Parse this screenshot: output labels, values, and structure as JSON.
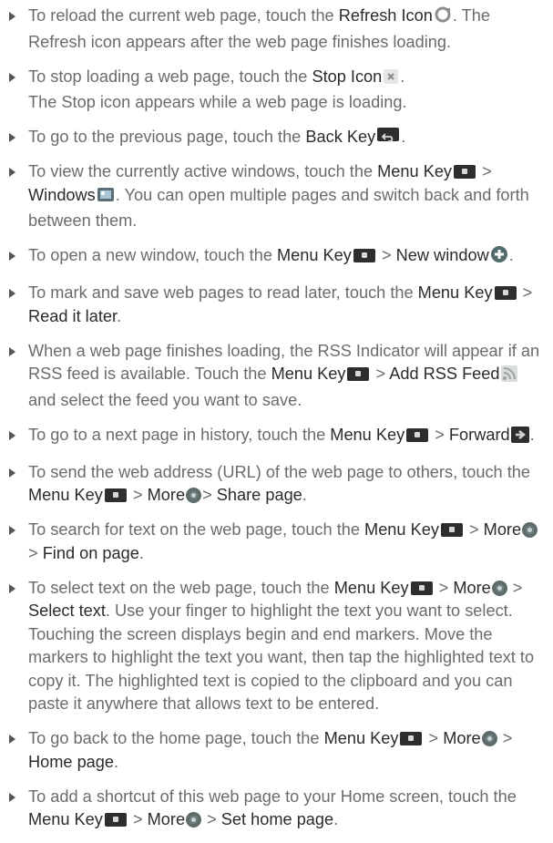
{
  "items": [
    {
      "parts": [
        {
          "t": "To reload the current web page, touch the "
        },
        {
          "b": "Refresh Icon"
        },
        {
          "icon": "refresh-icon"
        },
        {
          "t": ". The Refresh icon appears after the web page finishes loading."
        }
      ]
    },
    {
      "parts": [
        {
          "t": "To stop loading a web page, touch the "
        },
        {
          "b": "Stop Icon"
        },
        {
          "icon": "stop-icon"
        },
        {
          "t": "."
        },
        {
          "br": true
        },
        {
          "t": "The Stop icon appears while a web page is loading."
        }
      ]
    },
    {
      "parts": [
        {
          "t": "To go to the previous page, touch the "
        },
        {
          "b": "Back Key"
        },
        {
          "icon": "back-key-icon"
        },
        {
          "t": "."
        }
      ]
    },
    {
      "parts": [
        {
          "t": "To view the currently active windows, touch the "
        },
        {
          "b": "Menu Key"
        },
        {
          "icon": "menu-key-icon"
        },
        {
          "t": " > "
        },
        {
          "b": "Windows"
        },
        {
          "icon": "windows-icon"
        },
        {
          "t": ". You can open multiple pages and switch back and forth between them."
        }
      ]
    },
    {
      "parts": [
        {
          "t": "To open a new window, touch the "
        },
        {
          "b": "Menu Key"
        },
        {
          "icon": "menu-key-icon"
        },
        {
          "t": " > "
        },
        {
          "b": "New window"
        },
        {
          "icon": "new-window-icon"
        },
        {
          "t": "."
        }
      ]
    },
    {
      "parts": [
        {
          "t": "To mark and save web pages to read later, touch the "
        },
        {
          "b": "Menu Key"
        },
        {
          "icon": "menu-key-icon"
        },
        {
          "t": " > "
        },
        {
          "b": "Read it later"
        },
        {
          "t": "."
        }
      ]
    },
    {
      "parts": [
        {
          "t": "When a web page finishes loading, the RSS Indicator will appear if an RSS feed is available. Touch the "
        },
        {
          "b": "Menu Key"
        },
        {
          "icon": "menu-key-icon"
        },
        {
          "t": " > "
        },
        {
          "b": "Add RSS Feed"
        },
        {
          "icon": "rss-icon"
        },
        {
          "t": " and select the feed you want to save."
        }
      ]
    },
    {
      "parts": [
        {
          "t": "To go to a next page in history, touch the "
        },
        {
          "b": "Menu Key"
        },
        {
          "icon": "menu-key-icon"
        },
        {
          "t": " > "
        },
        {
          "b": "Forward"
        },
        {
          "icon": "forward-icon"
        },
        {
          "t": "."
        }
      ]
    },
    {
      "parts": [
        {
          "t": "To send the web address (URL) of the web page to others, touch the "
        },
        {
          "b": "Menu Key"
        },
        {
          "icon": "menu-key-icon"
        },
        {
          "t": " > "
        },
        {
          "b": "More"
        },
        {
          "icon": "more-icon"
        },
        {
          "t": "> "
        },
        {
          "b": "Share page"
        },
        {
          "t": "."
        }
      ]
    },
    {
      "parts": [
        {
          "t": "To search for text on the web page, touch the "
        },
        {
          "b": "Menu Key"
        },
        {
          "icon": "menu-key-icon"
        },
        {
          "t": " > "
        },
        {
          "b": "More"
        },
        {
          "icon": "more-icon"
        },
        {
          "t": "> "
        },
        {
          "b": "Find on page"
        },
        {
          "t": "."
        }
      ]
    },
    {
      "parts": [
        {
          "t": "To select text on the web page, touch the "
        },
        {
          "b": "Menu Key"
        },
        {
          "icon": "menu-key-icon"
        },
        {
          "t": " > "
        },
        {
          "b": "More"
        },
        {
          "icon": "more-icon"
        },
        {
          "t": " > "
        },
        {
          "b": "Select text"
        },
        {
          "t": ". Use your finger to highlight the text you want to select. Touching the screen displays begin and end markers. Move the markers to highlight the text you want, then tap the highlighted text to copy it. The highlighted text is copied to the clipboard and you can paste it anywhere that allows text to be entered."
        }
      ]
    },
    {
      "parts": [
        {
          "t": "To go back to the home page, touch the "
        },
        {
          "b": "Menu Key"
        },
        {
          "icon": "menu-key-icon"
        },
        {
          "t": " > "
        },
        {
          "b": "More"
        },
        {
          "icon": "more-icon"
        },
        {
          "t": " > "
        },
        {
          "b": "Home page"
        },
        {
          "t": "."
        }
      ]
    },
    {
      "parts": [
        {
          "t": "To add a shortcut of this web page to your Home screen, touch the "
        },
        {
          "b": "Menu Key"
        },
        {
          "icon": "menu-key-icon"
        },
        {
          "t": " > "
        },
        {
          "b": "More"
        },
        {
          "icon": "more-icon"
        },
        {
          "t": " > "
        },
        {
          "b": "Set home page"
        },
        {
          "t": "."
        }
      ]
    }
  ]
}
